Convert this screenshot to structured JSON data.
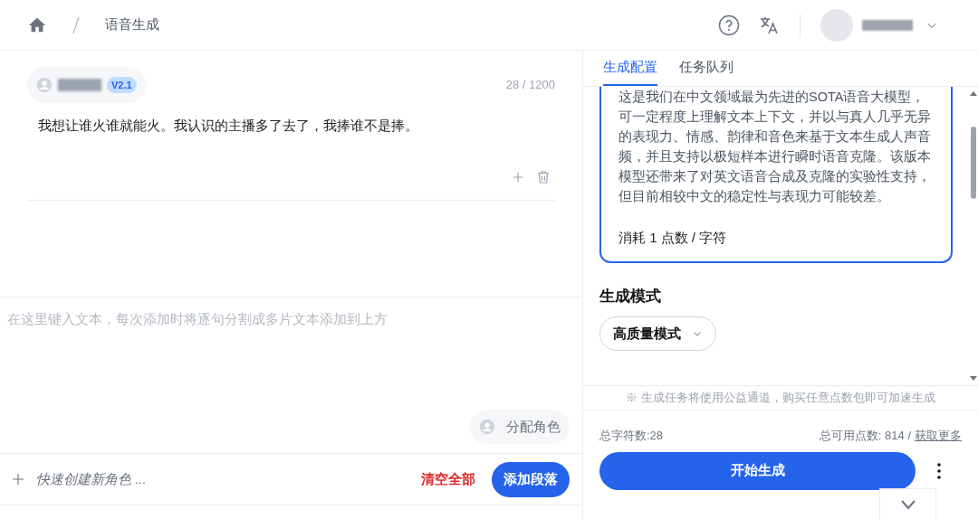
{
  "header": {
    "breadcrumb": "语音生成"
  },
  "paragraph": {
    "version_badge": "V2.1",
    "char_count": "28 / 1200",
    "text": "我想让谁火谁就能火。我认识的主播多了去了，我捧谁不是捧。"
  },
  "input": {
    "placeholder": "在这里键入文本，每次添加时将逐句分割成多片文本添加到上方",
    "assign_role": "分配角色"
  },
  "bottom_bar": {
    "quick_role_placeholder": "快速创建新角色 ...",
    "clear_all": "清空全部",
    "add_paragraph": "添加段落"
  },
  "tabs": [
    {
      "label": "生成配置",
      "selected": true
    },
    {
      "label": "任务队列",
      "selected": false
    }
  ],
  "model_card": {
    "description": "这是我们在中文领域最为先进的SOTA语音大模型，可一定程度上理解文本上下文，并以与真人几乎无异的表现力、情感、韵律和音色来基于文本生成人声音频，并且支持以极短样本进行瞬时语音克隆。该版本模型还带来了对英文语音合成及克隆的实验性支持，但目前相较中文的稳定性与表现力可能较差。",
    "cost": "消耗 1 点数 / 字符"
  },
  "mode": {
    "heading": "生成模式",
    "value": "高质量模式"
  },
  "notice": "※ 生成任务将使用公益通道，购买任意点数包即可加速生成",
  "footer": {
    "total_chars": "总字符数:28",
    "available_points": "总可用点数: 814 /",
    "get_more": "获取更多",
    "start": "开始生成"
  }
}
